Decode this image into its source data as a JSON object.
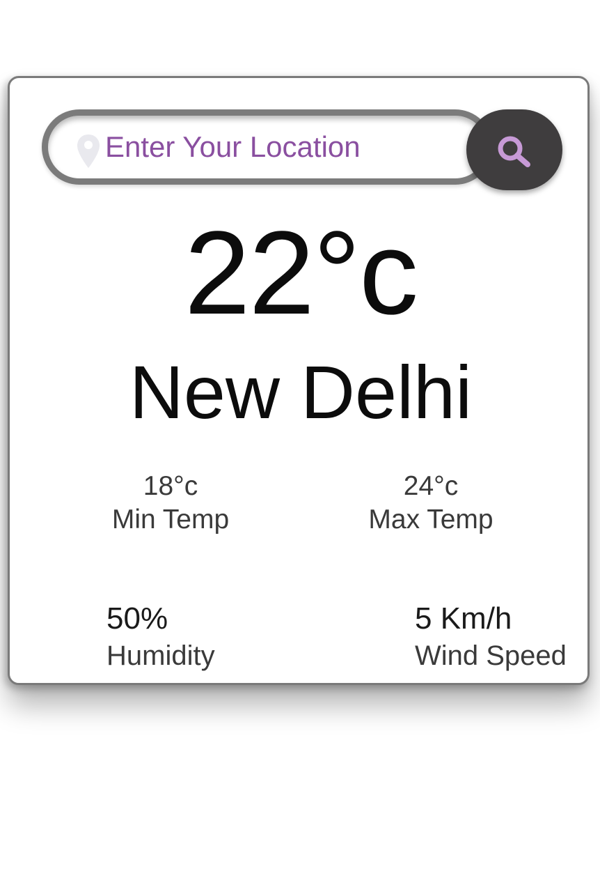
{
  "search": {
    "placeholder": "Enter Your Location",
    "value": "",
    "pin_icon": "location-pin-icon",
    "button_icon": "search-icon"
  },
  "weather": {
    "temperature": "22°c",
    "city": "New Delhi",
    "min_temp": {
      "value": "18°c",
      "label": "Min Temp"
    },
    "max_temp": {
      "value": "24°c",
      "label": "Max Temp"
    },
    "humidity": {
      "value": "50%",
      "label": "Humidity"
    },
    "wind_speed": {
      "value": "5 Km/h",
      "label": "Wind Speed"
    }
  },
  "colors": {
    "accent": "#8a4fa0",
    "search_icon": "#c79ad6",
    "button_bg": "#3f3d3e",
    "text_dark": "#0c0c0c",
    "text_muted": "#3a3a3a",
    "border": "#7b7b7b"
  }
}
